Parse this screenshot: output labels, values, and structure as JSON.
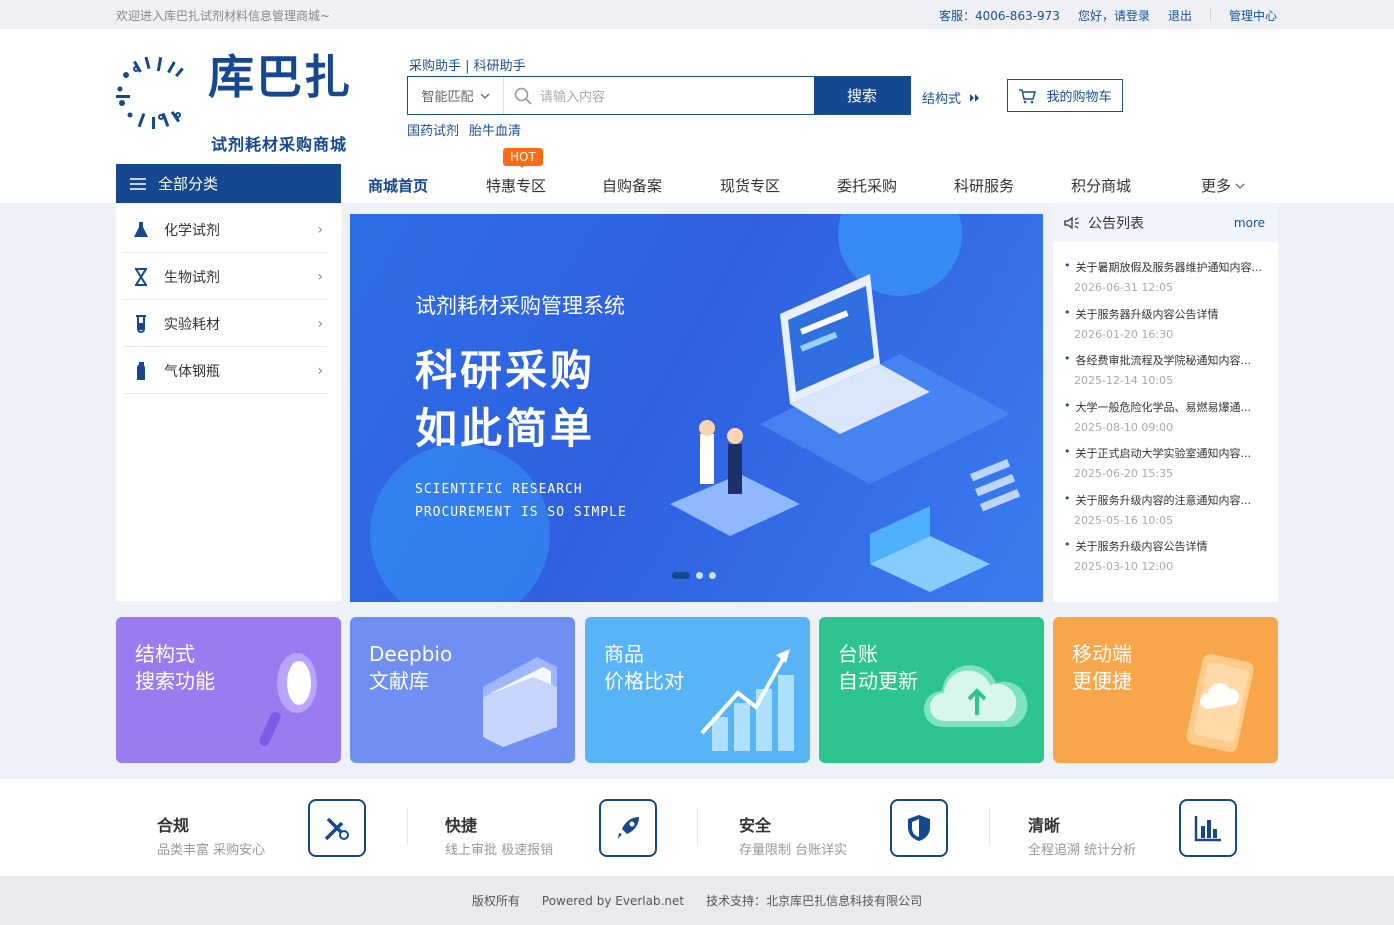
{
  "topbar": {
    "welcome": "欢迎进入库巴扎试剂材料信息管理商城~",
    "service": "客服：4006-863-973",
    "greeting": "您好，请登录",
    "logout": "退出",
    "admin": "管理中心"
  },
  "logo": {
    "brand": "库巴扎",
    "subtitle": "试剂耗材采购商城"
  },
  "search": {
    "helpers": "采购助手 | 科研助手",
    "mode": "智能匹配",
    "placeholder": "请输入内容",
    "button": "搜索",
    "hot_links": [
      "国药试剂",
      "胎牛血清"
    ],
    "structure": "结构式",
    "cart": "我的购物车"
  },
  "nav": {
    "all_categories": "全部分类",
    "items": [
      "商城首页",
      "特惠专区",
      "自购备案",
      "现货专区",
      "委托采购",
      "科研服务",
      "积分商城",
      "更多"
    ],
    "hot_badge": "HOT"
  },
  "categories": [
    {
      "label": "化学试剂",
      "icon": "flask-icon"
    },
    {
      "label": "生物试剂",
      "icon": "dna-icon"
    },
    {
      "label": "实验耗材",
      "icon": "test-tube-icon"
    },
    {
      "label": "气体钢瓶",
      "icon": "gas-cylinder-icon"
    }
  ],
  "banner": {
    "subtitle": "试剂耗材采购管理系统",
    "headline1": "科研采购",
    "headline2": "如此简单",
    "en1": "SCIENTIFIC RESEARCH",
    "en2": "PROCUREMENT IS SO SIMPLE",
    "slide_count": 3,
    "active_slide": 1
  },
  "notice": {
    "title": "公告列表",
    "more": "more",
    "items": [
      {
        "title": "关于暑期放假及服务器维护通知内容...",
        "date": "2026-06-31  12:05"
      },
      {
        "title": "关于服务器升级内容公告详情",
        "date": "2026-01-20  16:30"
      },
      {
        "title": "各经费审批流程及学院秘通知内容...",
        "date": "2025-12-14  10:05"
      },
      {
        "title": "大学一般危险化学品、易燃易爆通...",
        "date": "2025-08-10  09:00"
      },
      {
        "title": "关于正式启动大学实验室通知内容...",
        "date": "2025-06-20  15:35"
      },
      {
        "title": "关于服务升级内容的注意通知内容...",
        "date": "2025-05-16  10:05"
      },
      {
        "title": "关于服务升级内容公告详情",
        "date": "2025-03-10  12:00"
      }
    ]
  },
  "features": [
    {
      "line1": "结构式",
      "line2": "搜索功能",
      "color": "#9b7cf0",
      "icon": "magnifier-icon"
    },
    {
      "line1": "Deepbio",
      "line2": "文献库",
      "color": "#6f8ff4",
      "icon": "folder-icon"
    },
    {
      "line1": "商品",
      "line2": "价格比对",
      "color": "#56b4f7",
      "icon": "bar-chart-icon"
    },
    {
      "line1": "台账",
      "line2": "自动更新",
      "color": "#2ec48f",
      "icon": "cloud-upload-icon"
    },
    {
      "line1": "移动端",
      "line2": "更便捷",
      "color": "#f9a64a",
      "icon": "tablet-icon"
    }
  ],
  "advantages": [
    {
      "title": "合规",
      "desc": "品类丰富  采购安心",
      "icon": "tools-icon"
    },
    {
      "title": "快捷",
      "desc": "线上审批 极速报销",
      "icon": "rocket-icon"
    },
    {
      "title": "安全",
      "desc": "存量限制 台账详实",
      "icon": "shield-icon"
    },
    {
      "title": "清晰",
      "desc": "全程追溯 统计分析",
      "icon": "chart-icon"
    }
  ],
  "footer": {
    "copyright": "版权所有",
    "powered": "Powered by Everlab.net",
    "support": "技术支持：北京库巴扎信息科技有限公司"
  }
}
